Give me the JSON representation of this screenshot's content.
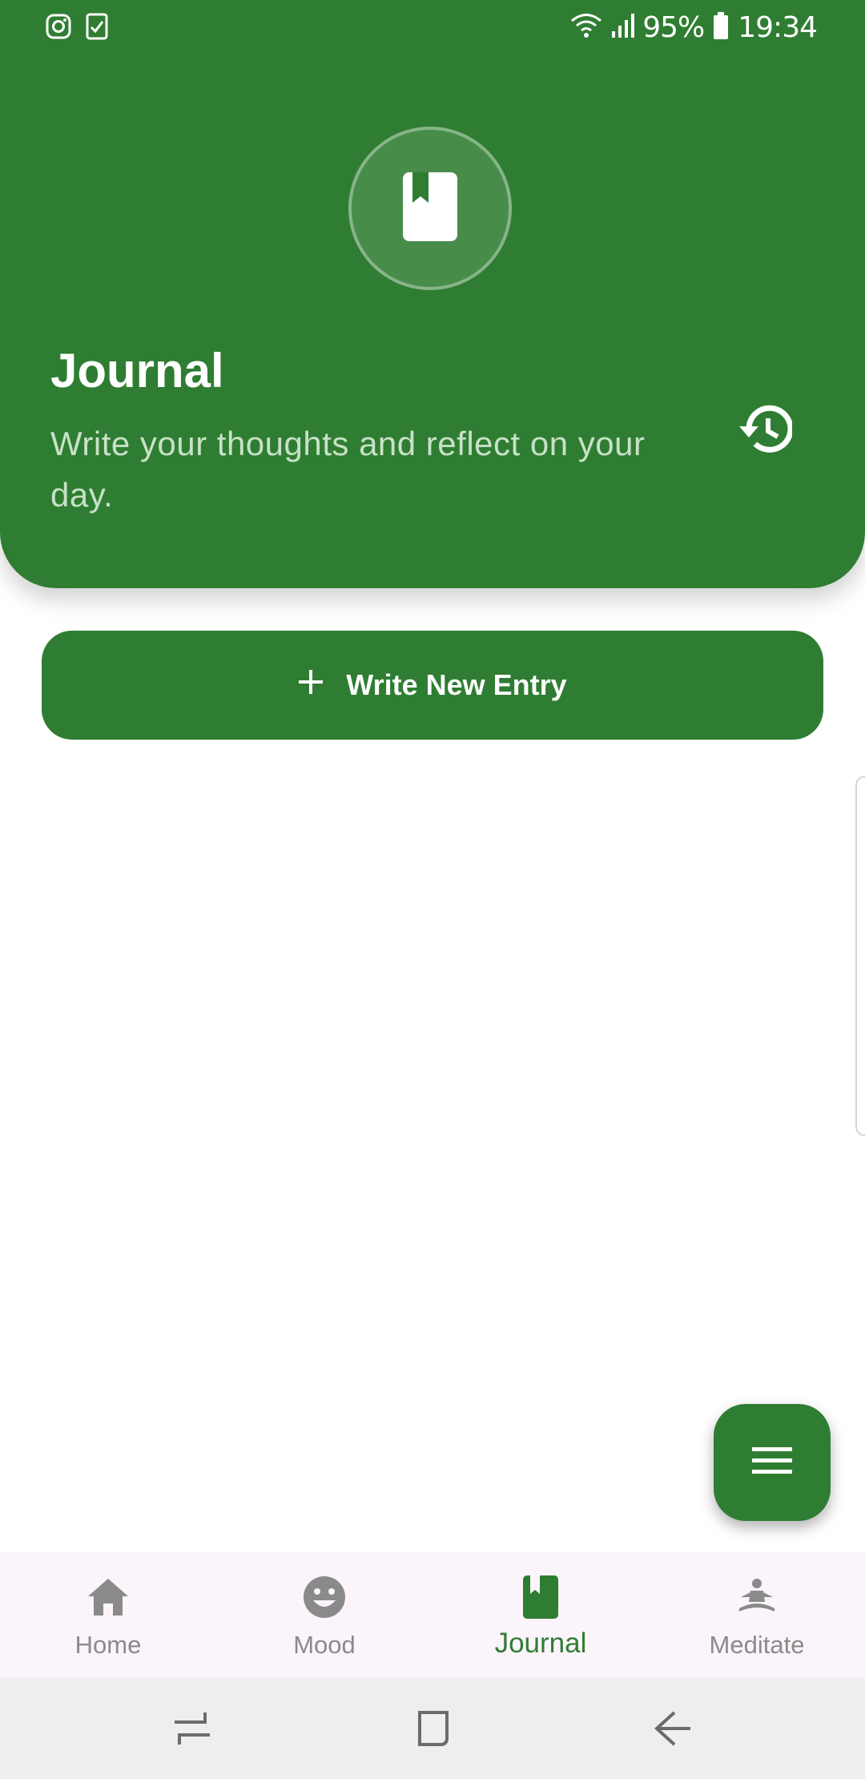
{
  "status_bar": {
    "battery": "95%",
    "time": "19:34",
    "left_icons": [
      "instagram-icon",
      "task-check-icon"
    ],
    "right_icons": [
      "wifi-icon",
      "signal-icon",
      "battery-icon"
    ]
  },
  "header": {
    "title": "Journal",
    "subtitle": "Write your thoughts and reflect on your day.",
    "logo_icon": "book-icon",
    "history_icon": "history-icon"
  },
  "actions": {
    "new_entry_label": "Write New Entry",
    "new_entry_icon": "plus-icon",
    "fab_icon": "menu-icon"
  },
  "bottom_nav": {
    "items": [
      {
        "label": "Home",
        "icon": "home-icon",
        "active": false
      },
      {
        "label": "Mood",
        "icon": "smiley-icon",
        "active": false
      },
      {
        "label": "Journal",
        "icon": "book-icon",
        "active": true
      },
      {
        "label": "Meditate",
        "icon": "meditate-icon",
        "active": false
      }
    ]
  },
  "colors": {
    "primary": "#2f7d32",
    "nav_background": "#fcf4fb",
    "inactive": "#8a8a8a"
  }
}
